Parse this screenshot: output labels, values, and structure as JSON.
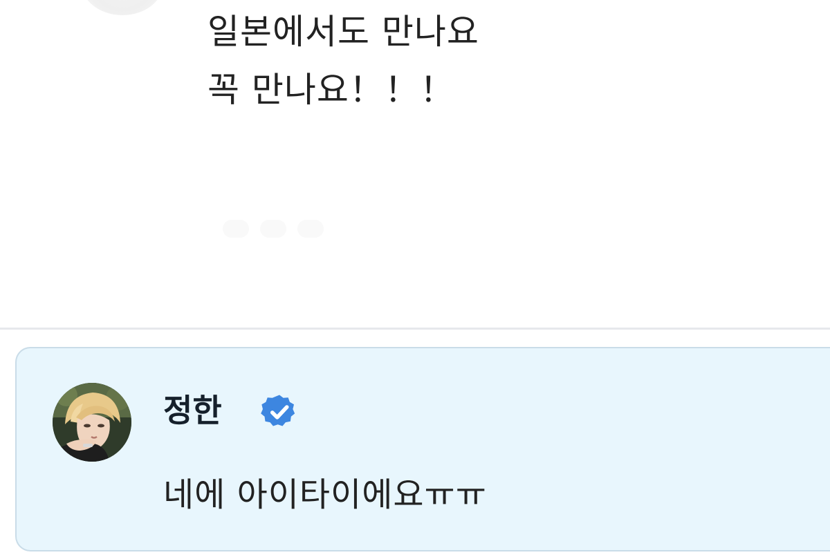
{
  "message": {
    "lines": [
      "일본에서도 만나요",
      "꼭 만나요！！！"
    ]
  },
  "reply": {
    "author_name": "정한",
    "verified": true,
    "text": "네에 아이타이에요ㅠㅠ",
    "card_background": "#e8f6fd",
    "badge_color": "#3d86e0"
  }
}
